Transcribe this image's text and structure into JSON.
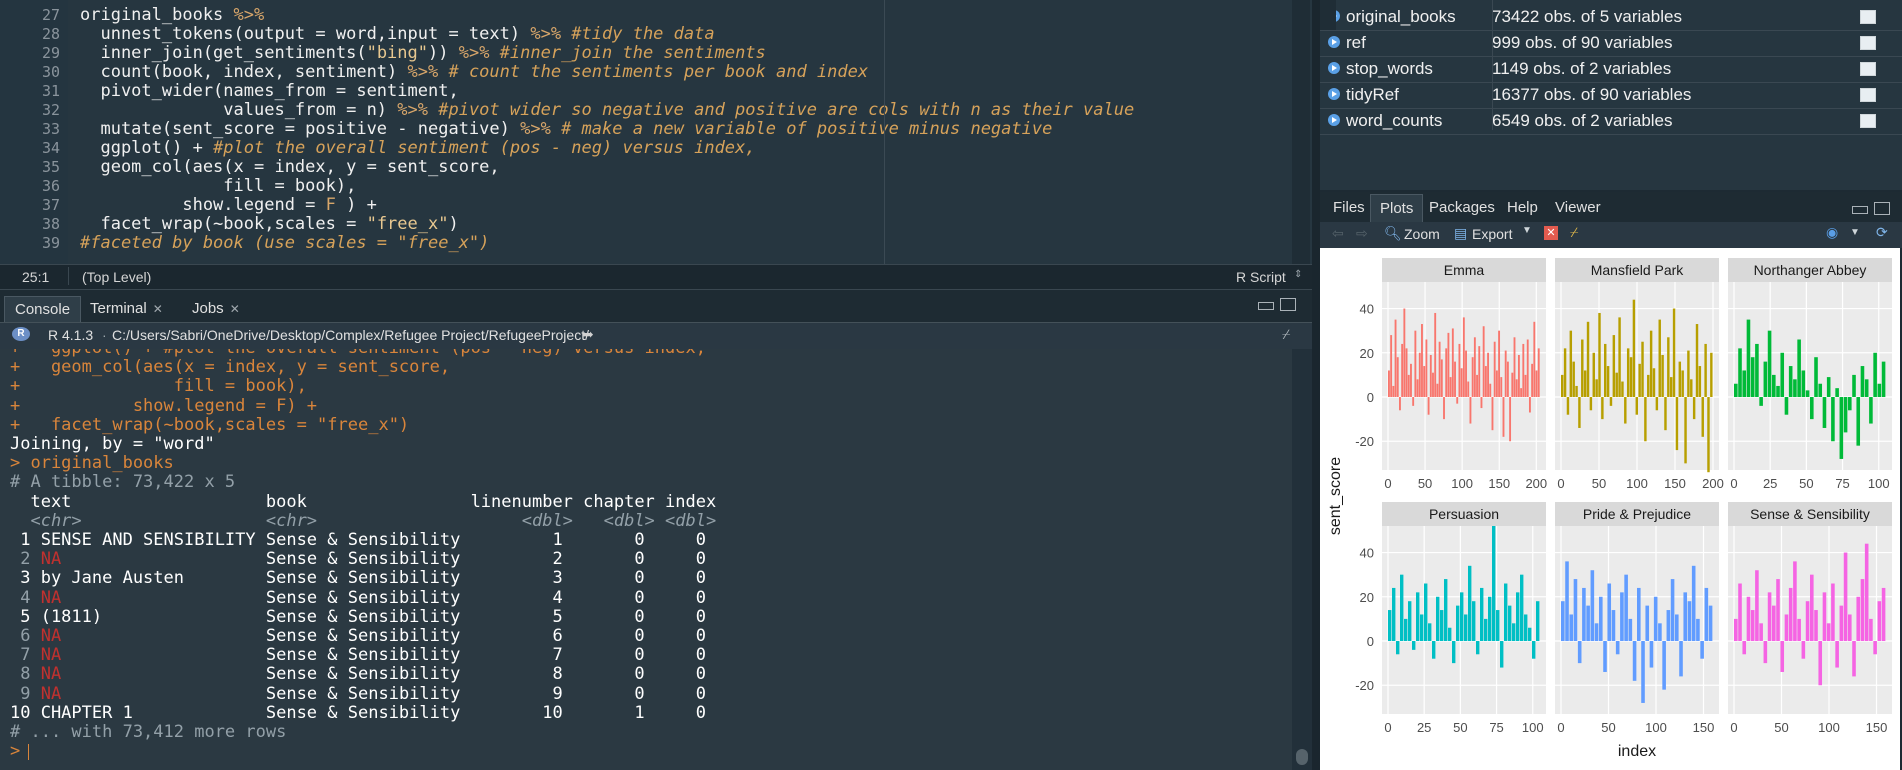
{
  "editor": {
    "lines": [
      {
        "n": "27",
        "parts": [
          [
            "",
            "original_books "
          ],
          [
            "op",
            "%>%"
          ]
        ]
      },
      {
        "n": "28",
        "parts": [
          [
            "",
            "  unnest_tokens(output = word,input = text) "
          ],
          [
            "op",
            "%>% "
          ],
          [
            "cm",
            "#tidy the data"
          ]
        ]
      },
      {
        "n": "29",
        "parts": [
          [
            "",
            "  inner_join(get_sentiments("
          ],
          [
            "st",
            "\"bing\""
          ],
          [
            "",
            "))"
          ],
          [
            "op",
            " %>% "
          ],
          [
            "cm",
            "#inner_join the sentiments"
          ]
        ]
      },
      {
        "n": "30",
        "parts": [
          [
            "",
            "  count(book, index, sentiment) "
          ],
          [
            "op",
            "%>% "
          ],
          [
            "cm",
            "# count the sentiments per book and index"
          ]
        ]
      },
      {
        "n": "31",
        "parts": [
          [
            "",
            "  pivot_wider(names_from = sentiment,"
          ]
        ]
      },
      {
        "n": "32",
        "parts": [
          [
            "",
            "              values_from = n) "
          ],
          [
            "op",
            "%>% "
          ],
          [
            "cm",
            "#pivot wider so negative and positive are cols with n as their value"
          ]
        ]
      },
      {
        "n": "33",
        "parts": [
          [
            "",
            "  mutate(sent_score = positive - negative) "
          ],
          [
            "op",
            "%>% "
          ],
          [
            "cm",
            "# make a new variable of positive minus negative"
          ]
        ]
      },
      {
        "n": "34",
        "parts": [
          [
            "",
            "  ggplot() + "
          ],
          [
            "cm",
            "#plot the overall sentiment (pos - neg) versus index,"
          ]
        ]
      },
      {
        "n": "35",
        "parts": [
          [
            "",
            "  geom_col(aes(x = index, y = sent_score,"
          ]
        ]
      },
      {
        "n": "36",
        "parts": [
          [
            "",
            "              fill = book),"
          ]
        ]
      },
      {
        "n": "37",
        "parts": [
          [
            "",
            "          show.legend = "
          ],
          [
            "op",
            "F"
          ],
          [
            "",
            " ) +"
          ]
        ]
      },
      {
        "n": "38",
        "parts": [
          [
            "",
            "  facet_wrap(~book,scales = "
          ],
          [
            "st",
            "\"free_x\""
          ],
          [
            "",
            ")"
          ]
        ]
      },
      {
        "n": "39",
        "parts": [
          [
            "cm",
            "#faceted by book (use scales = \"free_x\")"
          ]
        ]
      }
    ],
    "status": {
      "position": "25:1",
      "scope": "(Top Level)",
      "type": "R Script"
    }
  },
  "console": {
    "tabs": [
      {
        "label": "Console",
        "active": true,
        "closable": false
      },
      {
        "label": "Terminal",
        "active": false,
        "closable": true
      },
      {
        "label": "Jobs",
        "active": false,
        "closable": true
      }
    ],
    "version": "R 4.1.3",
    "path": "C:/Users/Sabri/OneDrive/Desktop/Complex/Refugee Project/RefugeeProject/",
    "lines": [
      {
        "cls": "echo",
        "text": "+   ggplot() + #plot the overall sentiment (pos - neg) versus index,"
      },
      {
        "cls": "echo",
        "text": "+   geom_col(aes(x = index, y = sent_score,"
      },
      {
        "cls": "echo",
        "text": "+               fill = book),"
      },
      {
        "cls": "echo",
        "text": "+           show.legend = F) +"
      },
      {
        "cls": "echo",
        "text": "+   facet_wrap(~book,scales = \"free_x\")"
      },
      {
        "cls": "",
        "text": "Joining, by = \"word\""
      },
      {
        "cls": "echo",
        "text": "> original_books"
      },
      {
        "cls": "dim",
        "text": "# A tibble: 73,422 x 5"
      },
      {
        "cls": "",
        "text": "  text                   book                linenumber chapter index"
      },
      {
        "cls": "it",
        "text": "  <chr>                  <chr>                    <dbl>   <dbl> <dbl>"
      },
      {
        "cls": "row",
        "text": " 1 SENSE AND SENSIBILITY Sense & Sensibility         1       0     0"
      },
      {
        "cls": "row",
        "text": " 2 NA                    Sense & Sensibility         2       0     0"
      },
      {
        "cls": "row",
        "text": " 3 by Jane Austen        Sense & Sensibility         3       0     0"
      },
      {
        "cls": "row",
        "text": " 4 NA                    Sense & Sensibility         4       0     0"
      },
      {
        "cls": "row",
        "text": " 5 (1811)                Sense & Sensibility         5       0     0"
      },
      {
        "cls": "row",
        "text": " 6 NA                    Sense & Sensibility         6       0     0"
      },
      {
        "cls": "row",
        "text": " 7 NA                    Sense & Sensibility         7       0     0"
      },
      {
        "cls": "row",
        "text": " 8 NA                    Sense & Sensibility         8       0     0"
      },
      {
        "cls": "row",
        "text": " 9 NA                    Sense & Sensibility         9       0     0"
      },
      {
        "cls": "row",
        "text": "10 CHAPTER 1             Sense & Sensibility        10       1     0"
      },
      {
        "cls": "dim",
        "text": "# ... with 73,412 more rows"
      },
      {
        "cls": "echo",
        "text": "> "
      }
    ]
  },
  "environment": {
    "rows": [
      {
        "name": "original_books",
        "value": "73422 obs. of 5 variables"
      },
      {
        "name": "ref",
        "value": "999 obs. of 90 variables"
      },
      {
        "name": "stop_words",
        "value": "1149 obs. of 2 variables"
      },
      {
        "name": "tidyRef",
        "value": "16377 obs. of 90 variables"
      },
      {
        "name": "word_counts",
        "value": "6549 obs. of 2 variables"
      }
    ]
  },
  "files_pane": {
    "tabs": [
      {
        "label": "Files",
        "active": false
      },
      {
        "label": "Plots",
        "active": true
      },
      {
        "label": "Packages",
        "active": false
      },
      {
        "label": "Help",
        "active": false
      },
      {
        "label": "Viewer",
        "active": false
      }
    ],
    "toolbar": {
      "zoom": "Zoom",
      "export": "Export"
    }
  },
  "chart_data": {
    "type": "bar",
    "xlabel": "index",
    "ylabel": "sent_score",
    "ylim": [
      -33,
      52
    ],
    "y_ticks": [
      -20,
      0,
      20,
      40
    ],
    "grid": true,
    "legend": "none",
    "panels": [
      {
        "name": "Emma",
        "color": "#f8766d",
        "x_ticks": [
          0,
          50,
          100,
          150,
          200
        ],
        "x_max": 205,
        "values": [
          12,
          28,
          5,
          35,
          18,
          -6,
          24,
          40,
          22,
          10,
          15,
          -4,
          30,
          8,
          20,
          33,
          14,
          26,
          -8,
          19,
          11,
          38,
          6,
          25,
          17,
          -10,
          22,
          29,
          9,
          31,
          16,
          -3,
          24,
          13,
          36,
          21,
          7,
          -12,
          18,
          27,
          10,
          23,
          -5,
          32,
          14,
          20,
          6,
          -15,
          25,
          12,
          30,
          9,
          -18,
          21,
          16,
          -20,
          11,
          27,
          8,
          19,
          4,
          24,
          10,
          26,
          -7,
          15,
          34,
          12,
          22
        ]
      },
      {
        "name": "Mansfield Park",
        "color": "#b79f00",
        "x_ticks": [
          0,
          50,
          100,
          150,
          200
        ],
        "x_max": 200,
        "values": [
          10,
          22,
          -8,
          30,
          16,
          5,
          -14,
          26,
          12,
          34,
          -6,
          20,
          8,
          38,
          -10,
          24,
          14,
          -4,
          28,
          11,
          36,
          7,
          -12,
          22,
          18,
          44,
          -8,
          15,
          25,
          -20,
          10,
          30,
          13,
          -6,
          35,
          19,
          -15,
          27,
          9,
          40,
          -24,
          16,
          12,
          -30,
          21,
          8,
          -10,
          33,
          14,
          -18,
          24,
          -34,
          20
        ]
      },
      {
        "name": "Northanger Abbey",
        "color": "#00ba38",
        "x_ticks": [
          0,
          25,
          50,
          75,
          100
        ],
        "x_max": 105,
        "values": [
          6,
          22,
          12,
          35,
          18,
          24,
          -4,
          16,
          30,
          10,
          5,
          20,
          -8,
          14,
          8,
          26,
          12,
          3,
          -10,
          18,
          6,
          -14,
          9,
          -20,
          4,
          -28,
          -16,
          -6,
          10,
          -22,
          14,
          8,
          -12,
          20,
          6,
          16
        ]
      },
      {
        "name": "Persuasion",
        "color": "#00bfc4",
        "x_ticks": [
          0,
          25,
          50,
          75,
          100
        ],
        "x_max": 105,
        "values": [
          14,
          24,
          -6,
          30,
          10,
          18,
          -4,
          22,
          12,
          26,
          8,
          -8,
          20,
          14,
          28,
          6,
          -10,
          16,
          22,
          12,
          34,
          18,
          -6,
          24,
          10,
          20,
          52,
          14,
          -12,
          26,
          16,
          8,
          22,
          30,
          12,
          6,
          -8,
          18
        ]
      },
      {
        "name": "Pride & Prejudice",
        "color": "#619cff",
        "x_ticks": [
          0,
          50,
          100,
          150
        ],
        "x_max": 160,
        "values": [
          18,
          36,
          12,
          28,
          -10,
          24,
          16,
          32,
          8,
          20,
          -14,
          26,
          14,
          -6,
          22,
          30,
          10,
          -18,
          24,
          -28,
          16,
          -12,
          20,
          8,
          -22,
          14,
          28,
          12,
          -16,
          22,
          18,
          34,
          10,
          -8,
          24,
          16
        ]
      },
      {
        "name": "Sense & Sensibility",
        "color": "#f564e3",
        "x_ticks": [
          0,
          50,
          100,
          150
        ],
        "x_max": 160,
        "values": [
          10,
          26,
          -6,
          20,
          14,
          32,
          8,
          -10,
          22,
          16,
          28,
          -14,
          12,
          24,
          36,
          10,
          -8,
          18,
          30,
          14,
          -20,
          22,
          8,
          26,
          -12,
          16,
          40,
          12,
          -16,
          20,
          28,
          44,
          10,
          -6,
          18,
          24
        ]
      }
    ]
  }
}
